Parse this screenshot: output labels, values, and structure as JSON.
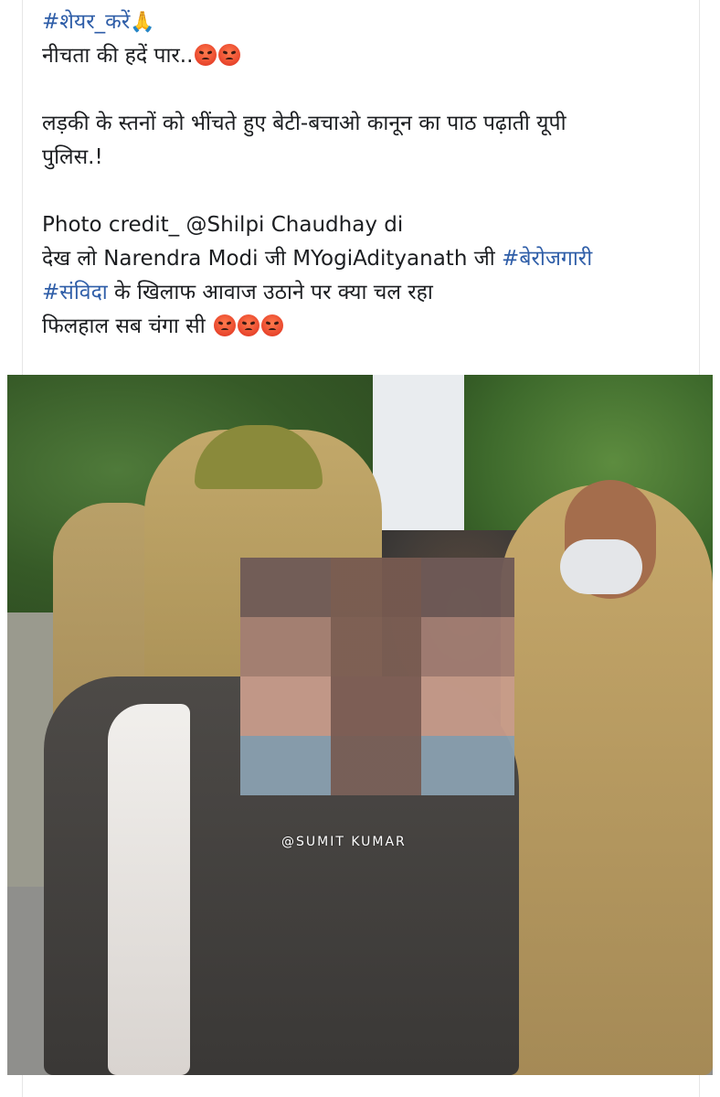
{
  "post": {
    "hashtag_share": "#शेयर_करें",
    "line_title": "नीचता की हदें पार..",
    "line_body_1": "लड़की के स्तनों को भींचते हुए बेटी-बचाओ कानून का पाठ पढ़ाती यूपी",
    "line_body_2": "पुलिस.!",
    "line_credit": "Photo credit_ @Shilpi Chaudhay di",
    "line_mention_prefix": "देख लो Narendra Modi जी MYogiAdityanath जी ",
    "hashtag_unemployment": "#बेरोजगारी",
    "hashtag_contract": "#संविदा",
    "line_contract_rest": " के खिलाफ आवाज उठाने पर क्या चल रहा",
    "line_final": "फिलहाल सब चंगा सी "
  },
  "icons": {
    "share_emoji": "folded-hands-icon",
    "angry_emoji": "angry-face-icon"
  },
  "photo": {
    "watermark": "@SUMIT KUMAR"
  },
  "colors": {
    "hashtag": "#2f5ea8",
    "text": "#1c1e21"
  }
}
